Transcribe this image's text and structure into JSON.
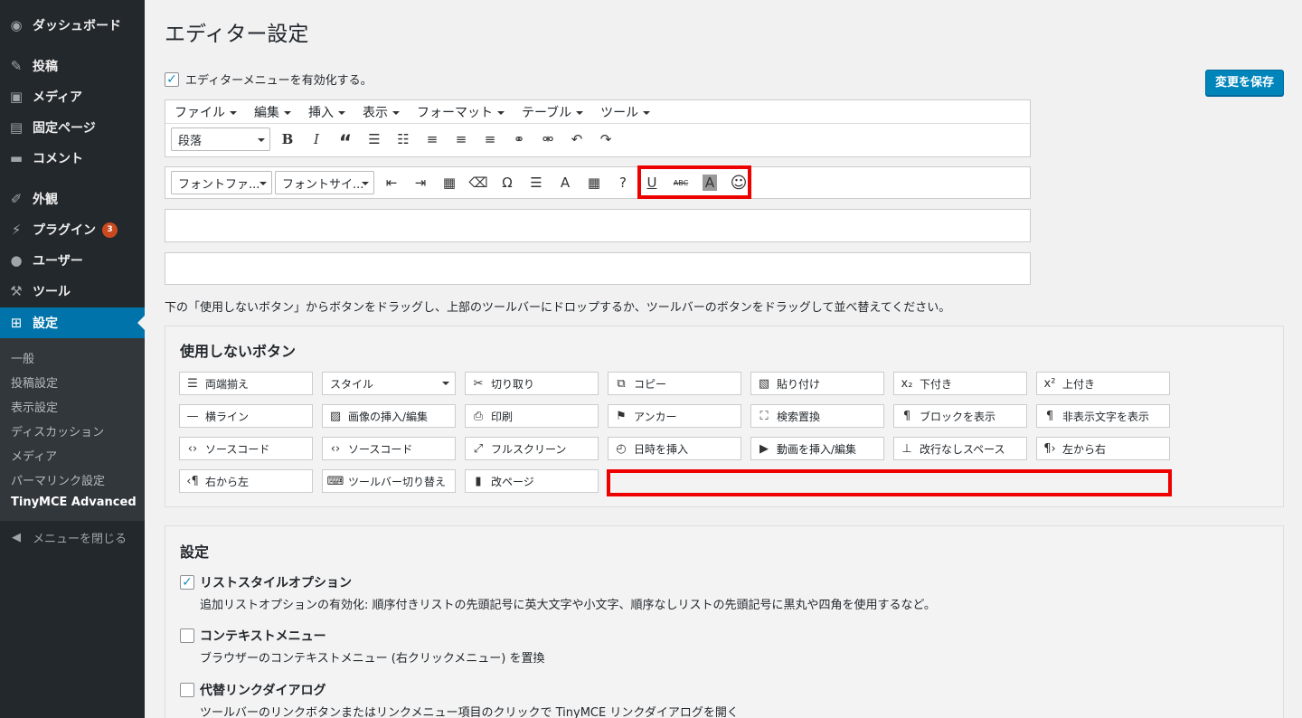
{
  "sidebar": {
    "menu": [
      {
        "label": "ダッシュボード",
        "icon": "dashboard-icon"
      },
      {
        "label": "投稿",
        "icon": "pin-icon"
      },
      {
        "label": "メディア",
        "icon": "media-icon"
      },
      {
        "label": "固定ページ",
        "icon": "page-icon"
      },
      {
        "label": "コメント",
        "icon": "comment-icon"
      },
      {
        "label": "外観",
        "icon": "brush-icon"
      },
      {
        "label": "プラグイン",
        "icon": "plugin-icon",
        "badge": "3"
      },
      {
        "label": "ユーザー",
        "icon": "user-icon"
      },
      {
        "label": "ツール",
        "icon": "wrench-icon"
      },
      {
        "label": "設定",
        "icon": "settings-icon"
      }
    ],
    "submenu": [
      "一般",
      "投稿設定",
      "表示設定",
      "ディスカッション",
      "メディア",
      "パーマリンク設定",
      "TinyMCE Advanced"
    ],
    "collapse": "メニューを閉じる"
  },
  "page": {
    "title": "エディター設定",
    "enable_label": "エディターメニューを有効化する。",
    "save_button": "変更を保存",
    "instructions": "下の「使用しないボタン」からボタンをドラッグし、上部のツールバーにドロップするか、ツールバーのボタンをドラッグして並べ替えてください。"
  },
  "editor": {
    "menubar": [
      "ファイル",
      "編集",
      "挿入",
      "表示",
      "フォーマット",
      "テーブル",
      "ツール"
    ],
    "format_select": "段落",
    "font_family_select": "フォントファ...",
    "font_size_select": "フォントサイ..."
  },
  "unused": {
    "title": "使用しないボタン",
    "buttons": [
      "両端揃え",
      "スタイル",
      "切り取り",
      "コピー",
      "貼り付け",
      "下付き",
      "上付き",
      "横ライン",
      "画像の挿入/編集",
      "印刷",
      "アンカー",
      "検索置換",
      "ブロックを表示",
      "非表示文字を表示",
      "ソースコード",
      "ソースコード",
      "フルスクリーン",
      "日時を挿入",
      "動画を挿入/編集",
      "改行なしスペース",
      "左から右",
      "右から左",
      "ツールバー切り替え",
      "改ページ"
    ]
  },
  "settings": {
    "title": "設定",
    "options": [
      {
        "label": "リストスタイルオプション",
        "desc": "追加リストオプションの有効化: 順序付きリストの先頭記号に英大文字や小文字、順序なしリストの先頭記号に黒丸や四角を使用するなど。",
        "checked": true
      },
      {
        "label": "コンテキストメニュー",
        "desc": "ブラウザーのコンテキストメニュー (右クリックメニュー) を置換",
        "checked": false
      },
      {
        "label": "代替リンクダイアログ",
        "desc": "ツールバーのリンクボタンまたはリンクメニュー項目のクリックで TinyMCE リンクダイアログを開く",
        "checked": false
      }
    ]
  },
  "colors": {
    "sidebar_bg": "#23282d",
    "active": "#0073aa",
    "highlight": "#e00000",
    "badge": "#ca4a1f"
  }
}
